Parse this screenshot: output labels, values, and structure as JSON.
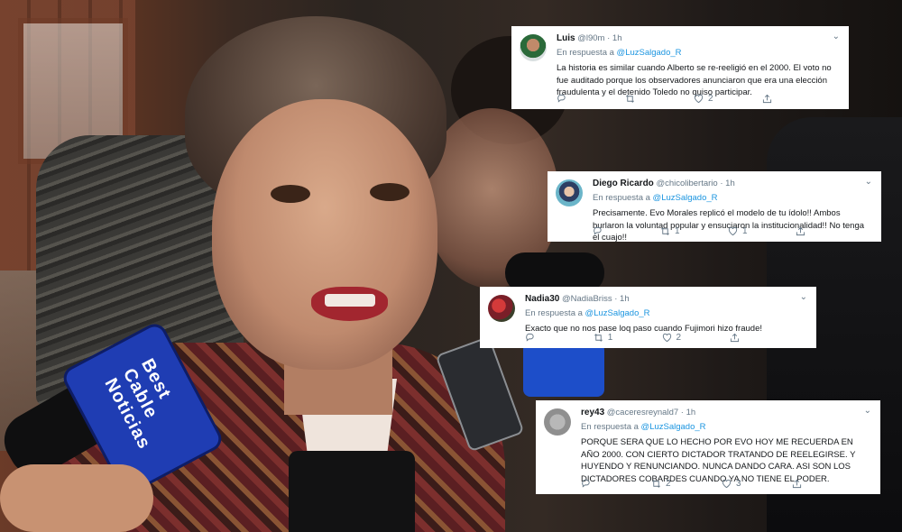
{
  "tweets": [
    {
      "name": "Luis",
      "handle": "@l90m",
      "time": "1h",
      "reply_prefix": "En respuesta a",
      "reply_to": "@LuzSalgado_R",
      "text": "La historia es similar cuando Alberto se re-reeligió en el 2000. El voto no fue auditado porque los observadores anunciaron que era una elección fraudulenta y el detenido Toledo no quiso participar.",
      "retweets": "",
      "likes": "2"
    },
    {
      "name": "Diego Ricardo",
      "handle": "@chicolibertario",
      "time": "1h",
      "reply_prefix": "En respuesta a",
      "reply_to": "@LuzSalgado_R",
      "text": "Precisamente. Evo Morales replicó el modelo de tu ídolo!! Ambos burlaron la voluntad popular y ensuciaron la institucionalidad!! No tenga el cuajo!!",
      "retweets": "1",
      "likes": "1"
    },
    {
      "name": "Nadia30",
      "handle": "@NadiaBriss",
      "time": "1h",
      "reply_prefix": "En respuesta a",
      "reply_to": "@LuzSalgado_R",
      "text": "Exacto que no nos pase loq paso cuando Fujimori hizo fraude!",
      "retweets": "1",
      "likes": "2"
    },
    {
      "name": "rey43",
      "handle": "@caceresreynald7",
      "time": "1h",
      "reply_prefix": "En respuesta a",
      "reply_to": "@LuzSalgado_R",
      "text": "PORQUE SERA QUE LO HECHO POR EVO HOY ME RECUERDA  EN AÑO 2000. CON CIERTO DICTADOR TRATANDO DE REELEGIRSE. Y HUYENDO Y RENUNCIANDO. NUNCA DANDO CARA. ASI SON LOS DICTADORES COBARDES CUANDO YA NO TIENE EL PODER.",
      "retweets": "2",
      "likes": "3"
    }
  ],
  "photo": {
    "mic_brand": "Best Cable Noticias"
  },
  "colors": {
    "link": "#1b95e0",
    "muted": "#657786",
    "text": "#14171a"
  }
}
